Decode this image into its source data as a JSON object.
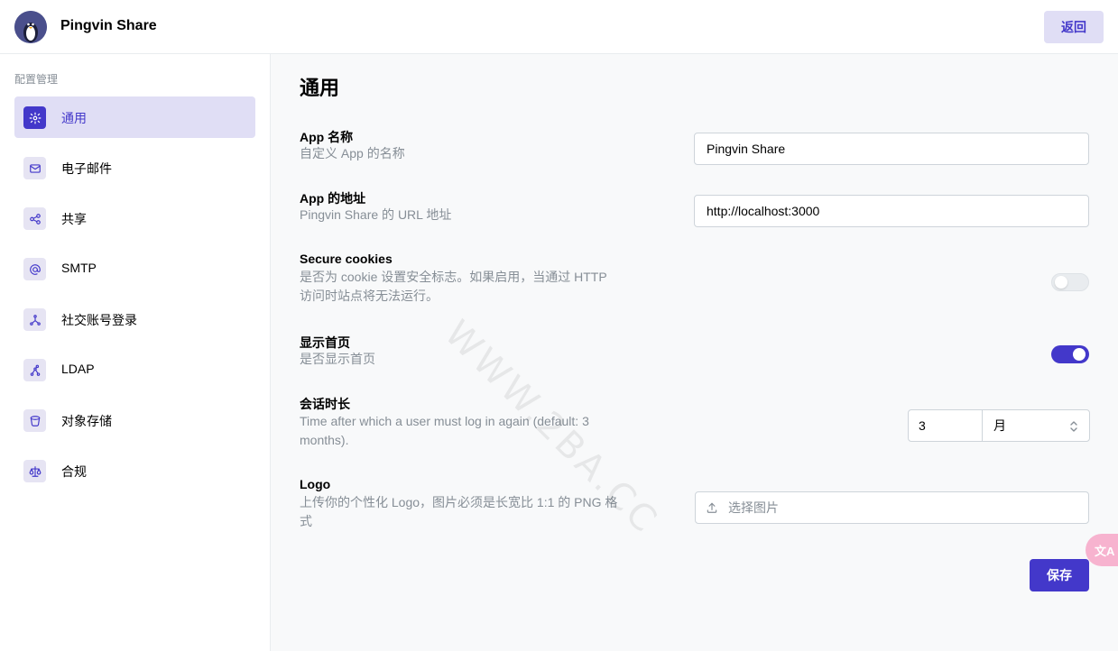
{
  "header": {
    "app_name": "Pingvin Share",
    "back_label": "返回"
  },
  "sidebar": {
    "heading": "配置管理",
    "items": [
      {
        "label": "通用",
        "icon": "gear-icon",
        "active": true
      },
      {
        "label": "电子邮件",
        "icon": "mail-icon",
        "active": false
      },
      {
        "label": "共享",
        "icon": "share-icon",
        "active": false
      },
      {
        "label": "SMTP",
        "icon": "at-icon",
        "active": false
      },
      {
        "label": "社交账号登录",
        "icon": "social-login-icon",
        "active": false
      },
      {
        "label": "LDAP",
        "icon": "ldap-icon",
        "active": false
      },
      {
        "label": "对象存储",
        "icon": "bucket-icon",
        "active": false
      },
      {
        "label": "合规",
        "icon": "scale-icon",
        "active": false
      }
    ]
  },
  "main": {
    "title": "通用",
    "settings": {
      "app_name": {
        "label": "App 名称",
        "description": "自定义 App 的名称",
        "value": "Pingvin Share"
      },
      "app_url": {
        "label": "App 的地址",
        "description": "Pingvin Share 的 URL 地址",
        "value": "http://localhost:3000"
      },
      "secure_cookies": {
        "label": "Secure cookies",
        "description": "是否为 cookie 设置安全标志。如果启用，当通过 HTTP 访问时站点将无法运行。",
        "enabled": false
      },
      "show_home": {
        "label": "显示首页",
        "description": "是否显示首页",
        "enabled": true
      },
      "session_duration": {
        "label": "会话时长",
        "description": "Time after which a user must log in again (default: 3 months).",
        "value": "3",
        "unit": "月"
      },
      "logo": {
        "label": "Logo",
        "description": "上传你的个性化 Logo，图片必须是长宽比 1:1 的 PNG 格式",
        "placeholder": "选择图片"
      }
    },
    "save_label": "保存"
  },
  "overlay": {
    "watermark": "WWW.2BA.CC",
    "translate_label": "文A"
  },
  "colors": {
    "accent": "#4338ca",
    "accent_light": "#e0def5",
    "muted_text": "#868e96"
  }
}
